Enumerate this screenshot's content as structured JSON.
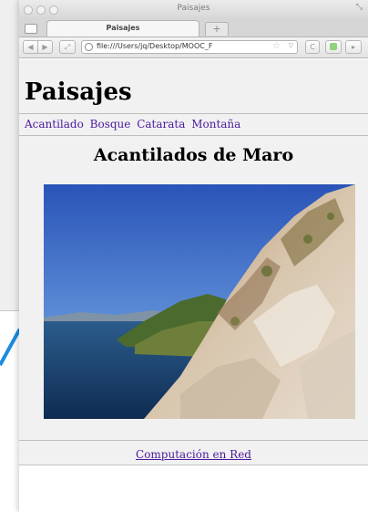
{
  "window": {
    "title": "Paisajes"
  },
  "tabs": [
    {
      "label": "Paisajes",
      "active": true
    }
  ],
  "toolbar": {
    "back_symbol": "◀",
    "forward_symbol": "▶",
    "resize_symbol": "⤢",
    "url": "file:///Users/jq/Desktop/MOOC_F",
    "reload_symbol": "C",
    "more_symbol": "▸",
    "new_tab_symbol": "+"
  },
  "page": {
    "site_title": "Paisajes",
    "nav_links": [
      "Acantilado",
      "Bosque",
      "Catarata",
      "Montaña"
    ],
    "article_title": "Acantilados de Maro",
    "footer_link": "Computación en Red"
  },
  "colors": {
    "link": "#4b1a9c",
    "page_background": "#f1f1f1",
    "accent_arrow": "#1a8be0"
  }
}
